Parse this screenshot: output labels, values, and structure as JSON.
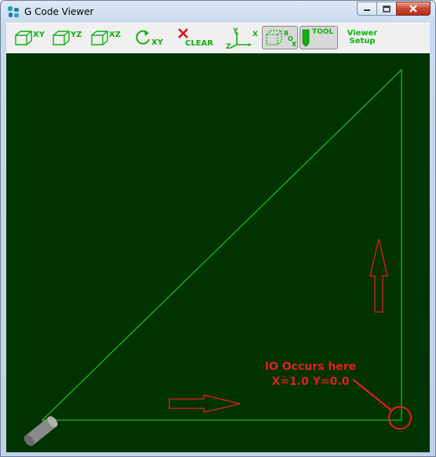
{
  "window": {
    "title": "G Code Viewer"
  },
  "toolbar": {
    "view_xy": "XY",
    "view_yz": "YZ",
    "view_xz": "XZ",
    "rotate_xy": "XY",
    "clear": "CLEAR",
    "axes_y": "Y",
    "axes_x": "X",
    "axes_z": "Z",
    "box_b": "B",
    "box_o": "O",
    "box_x": "X",
    "tool": "TOOL",
    "viewer_setup_line1": "Viewer",
    "viewer_setup_line2": "Setup"
  },
  "viewport": {
    "background": "#003300",
    "path_color": "#20e020",
    "annotation_color": "#e02020",
    "annotation_line1": "IO Occurs here",
    "annotation_line2": "X=1.0 Y=0.0"
  }
}
